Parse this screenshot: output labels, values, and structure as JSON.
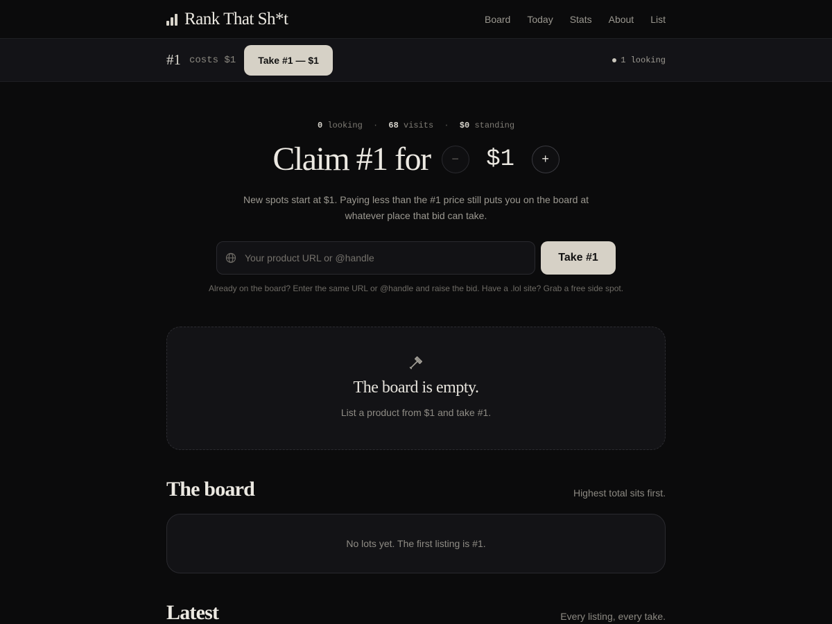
{
  "brand": {
    "name": "Rank That Sh*t"
  },
  "nav": [
    "Board",
    "Today",
    "Stats",
    "About",
    "List"
  ],
  "strip": {
    "rank": "#1",
    "costs": "costs $1",
    "button": "Take #1 — $1",
    "looking": "1 looking"
  },
  "stats": {
    "looking_value": "0",
    "looking_label": "looking",
    "visits_value": "68",
    "visits_label": "visits",
    "standing_value": "$0",
    "standing_label": "standing"
  },
  "claim": {
    "text": "Claim #1 for",
    "minus": "−",
    "price": "$1",
    "plus": "+"
  },
  "hint": "New spots start at $1. Paying less than the #1 price still puts you on the board at whatever place that bid can take.",
  "form": {
    "placeholder": "Your product URL or @handle",
    "value": "",
    "button": "Take #1",
    "subhint": "Already on the board? Enter the same URL or @handle and raise the bid. Have a .lol site? Grab a free side spot."
  },
  "empty": {
    "title": "The board is empty.",
    "subtitle": "List a product from $1 and take #1."
  },
  "board": {
    "title": "The board",
    "note": "Highest total sits first.",
    "empty_text": "No lots yet. The first listing is #1."
  },
  "latest": {
    "title": "Latest",
    "note": "Every listing, every take."
  },
  "icons": {
    "brand": "bar-chart-icon",
    "globe": "globe-icon",
    "gavel": "gavel-icon"
  },
  "colors": {
    "background": "#0b0b0c",
    "surface": "#131316",
    "accent_button": "#d6d1c6",
    "text": "#ece9e2",
    "muted": "#8f8c85"
  }
}
